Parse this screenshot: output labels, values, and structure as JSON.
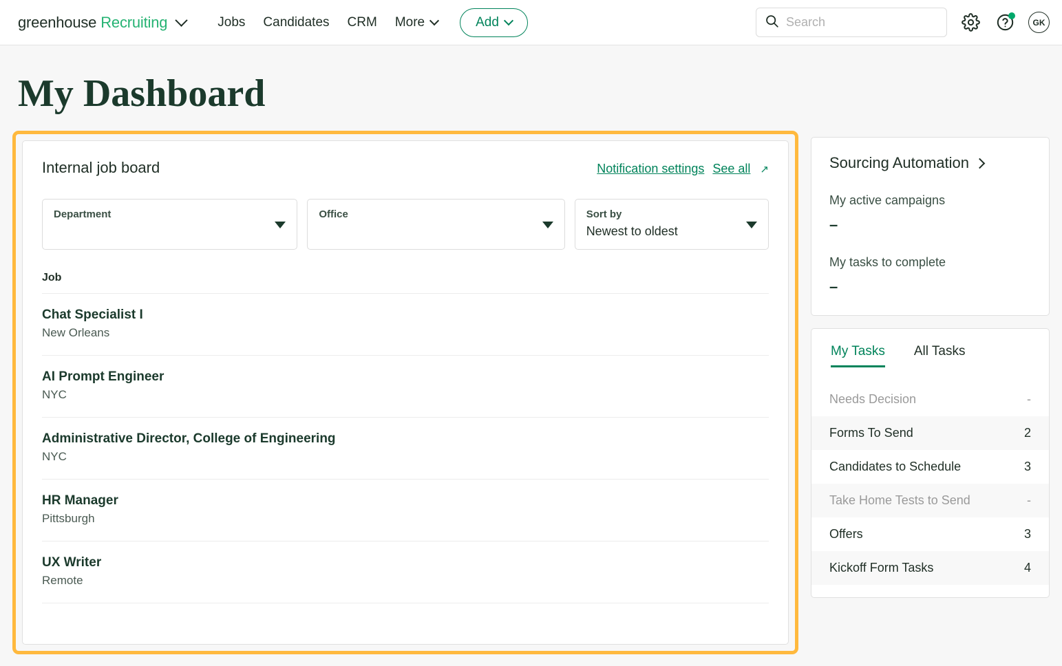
{
  "header": {
    "brand_primary": "greenhouse",
    "brand_secondary": "Recruiting",
    "nav": [
      {
        "label": "Jobs"
      },
      {
        "label": "Candidates"
      },
      {
        "label": "CRM"
      },
      {
        "label": "More"
      }
    ],
    "add_label": "Add",
    "search_placeholder": "Search",
    "search_value": "",
    "avatar_initials": "GK",
    "icons": {
      "search": "search-icon",
      "settings": "gear-icon",
      "help": "help-circle-icon",
      "help_badge": "notification-dot"
    },
    "colors": {
      "brand_green": "#26b373",
      "action_green": "#00835a",
      "badge_green": "#00a86b",
      "dark_green": "#1b3a2c"
    }
  },
  "page": {
    "title": "My Dashboard",
    "highlight_color": "#ffb93e"
  },
  "job_board": {
    "title": "Internal job board",
    "notification_settings_label": "Notification settings",
    "see_all_label": "See all",
    "see_all_icon": "↗",
    "filters": [
      {
        "label": "Department",
        "value": ""
      },
      {
        "label": "Office",
        "value": ""
      },
      {
        "label": "Sort by",
        "value": "Newest to oldest"
      }
    ],
    "column_header": "Job",
    "jobs": [
      {
        "title": "Chat Specialist I",
        "location": "New Orleans"
      },
      {
        "title": "AI Prompt Engineer",
        "location": "NYC"
      },
      {
        "title": "Administrative Director, College of Engineering",
        "location": "NYC"
      },
      {
        "title": "HR Manager",
        "location": "Pittsburgh"
      },
      {
        "title": "UX Writer",
        "location": "Remote"
      }
    ]
  },
  "sourcing_automation": {
    "title": "Sourcing Automation",
    "metrics": [
      {
        "label": "My active campaigns",
        "value": "–"
      },
      {
        "label": "My tasks to complete",
        "value": "–"
      }
    ]
  },
  "tasks": {
    "tabs": [
      {
        "label": "My Tasks",
        "active": true
      },
      {
        "label": "All Tasks",
        "active": false
      }
    ],
    "rows": [
      {
        "label": "Needs Decision",
        "count": "-",
        "muted": true
      },
      {
        "label": "Forms To Send",
        "count": "2",
        "muted": false
      },
      {
        "label": "Candidates to Schedule",
        "count": "3",
        "muted": false
      },
      {
        "label": "Take Home Tests to Send",
        "count": "-",
        "muted": true
      },
      {
        "label": "Offers",
        "count": "3",
        "muted": false
      },
      {
        "label": "Kickoff Form Tasks",
        "count": "4",
        "muted": false
      }
    ]
  }
}
